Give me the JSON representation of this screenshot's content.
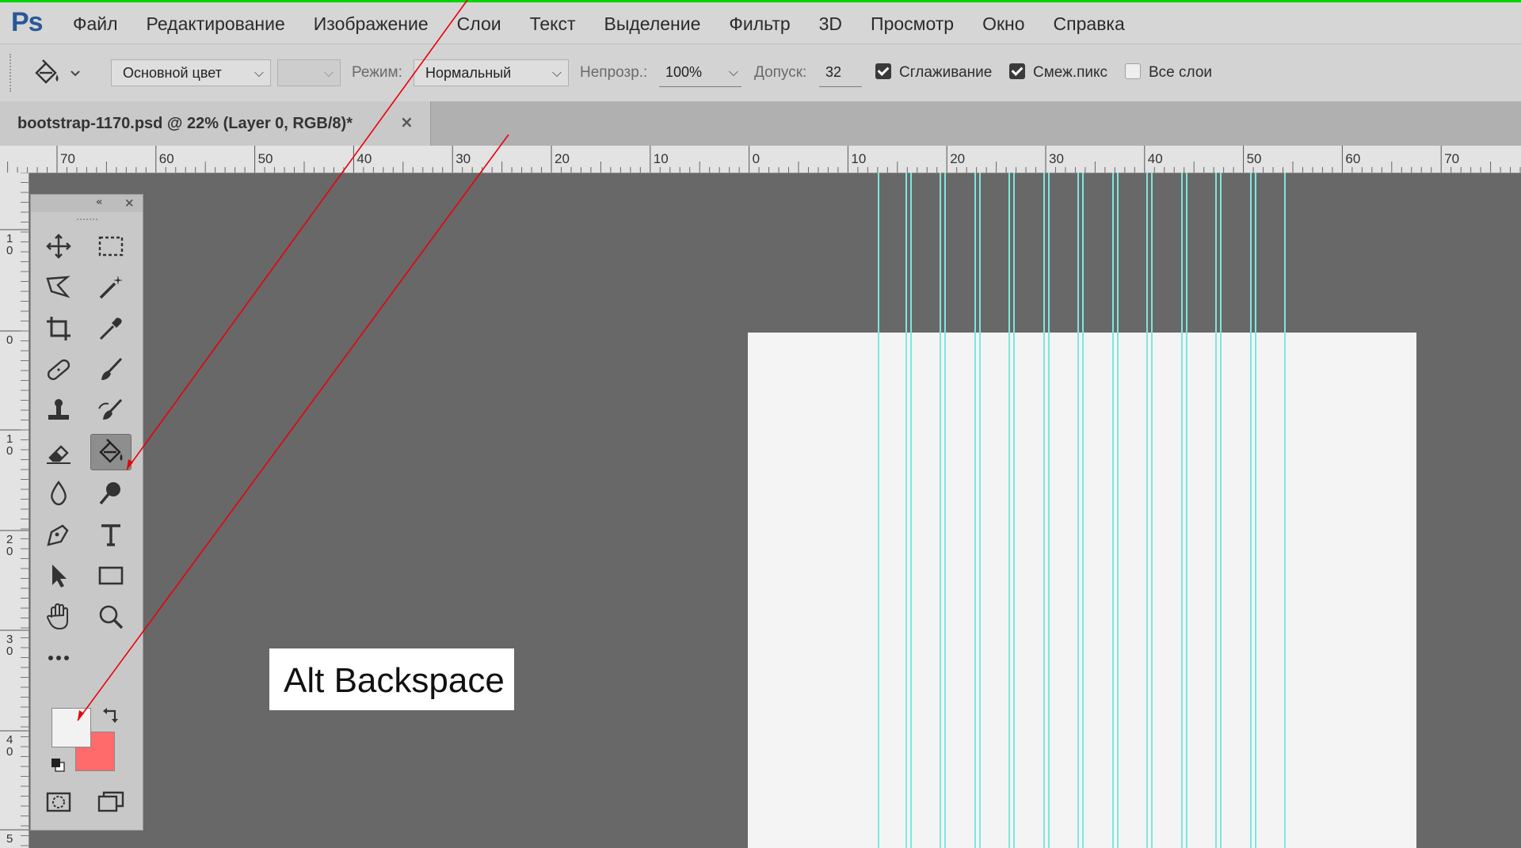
{
  "app": {
    "logo": "Ps"
  },
  "menu": [
    "Файл",
    "Редактирование",
    "Изображение",
    "Слои",
    "Текст",
    "Выделение",
    "Фильтр",
    "3D",
    "Просмотр",
    "Окно",
    "Справка"
  ],
  "options": {
    "tool_icon": "paint-bucket-icon",
    "fill_source": "Основной цвет",
    "mode_label": "Режим:",
    "mode_value": "Нормальный",
    "opacity_label": "Непрозр.:",
    "opacity_value": "100%",
    "tolerance_label": "Допуск:",
    "tolerance_value": "32",
    "antialias_label": "Сглаживание",
    "antialias_checked": true,
    "contiguous_label": "Смеж.пикс",
    "contiguous_checked": true,
    "all_layers_label": "Все слои",
    "all_layers_checked": false
  },
  "document": {
    "tab_title": "bootstrap-1170.psd @ 22% (Layer 0, RGB/8)",
    "modified_marker": "*",
    "close_label": "×"
  },
  "ruler": {
    "horizontal_labels": [
      "70",
      "60",
      "50",
      "40",
      "30",
      "20",
      "10",
      "0",
      "10",
      "20",
      "30",
      "40",
      "50",
      "60",
      "70"
    ],
    "vertical_labels": [
      "1\n0",
      "0",
      "1\n0",
      "2\n0",
      "3\n0",
      "4\n0",
      "5"
    ]
  },
  "toolbox": {
    "tools": [
      {
        "name": "move-tool",
        "icon": "move-icon"
      },
      {
        "name": "marquee-tool",
        "icon": "rect-marquee-icon"
      },
      {
        "name": "lasso-tool",
        "icon": "polygonal-lasso-icon"
      },
      {
        "name": "magic-wand-tool",
        "icon": "magic-wand-icon"
      },
      {
        "name": "crop-tool",
        "icon": "crop-icon"
      },
      {
        "name": "eyedropper-tool",
        "icon": "eyedropper-icon"
      },
      {
        "name": "healing-tool",
        "icon": "bandage-icon"
      },
      {
        "name": "brush-tool",
        "icon": "brush-icon"
      },
      {
        "name": "stamp-tool",
        "icon": "stamp-icon"
      },
      {
        "name": "history-brush-tool",
        "icon": "history-brush-icon"
      },
      {
        "name": "eraser-tool",
        "icon": "eraser-icon"
      },
      {
        "name": "paint-bucket-tool",
        "icon": "paint-bucket-icon",
        "active": true
      },
      {
        "name": "blur-tool",
        "icon": "drop-icon"
      },
      {
        "name": "dodge-tool",
        "icon": "dodge-icon"
      },
      {
        "name": "pen-tool",
        "icon": "pen-icon"
      },
      {
        "name": "type-tool",
        "icon": "type-icon"
      },
      {
        "name": "path-select-tool",
        "icon": "arrow-icon"
      },
      {
        "name": "shape-tool",
        "icon": "rectangle-icon"
      },
      {
        "name": "hand-tool",
        "icon": "hand-icon"
      },
      {
        "name": "zoom-tool",
        "icon": "zoom-icon"
      },
      {
        "name": "more-tools",
        "icon": "ellipsis-icon"
      }
    ],
    "foreground_color": "#f2f2f2",
    "background_color": "#ff6b6b"
  },
  "guides_color": "#7fe6e0",
  "annotation": {
    "text": "Alt Backspace",
    "arrow_color": "#e8000a"
  }
}
